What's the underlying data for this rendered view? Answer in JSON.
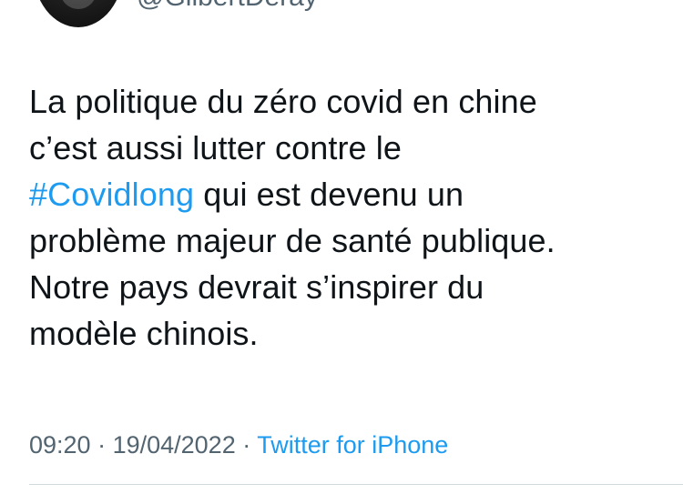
{
  "tweet": {
    "handle": "@GilbertDeray",
    "lines": {
      "l1": "La politique du zéro covid en chine",
      "l2": "c’est aussi lutter contre le",
      "l3_hashtag": "#Covidlong",
      "l3_rest": " qui est devenu un",
      "l4": "problème majeur de santé publique.",
      "l5": "Notre pays devrait s’inspirer du",
      "l6": "modèle chinois."
    },
    "meta": {
      "time": "09:20",
      "separator": " · ",
      "date": "19/04/2022",
      "source": "Twitter for iPhone"
    }
  },
  "colors": {
    "text": "#0f1419",
    "secondary": "#536471",
    "link": "#1d9bf0",
    "divider": "#cfd9de"
  }
}
